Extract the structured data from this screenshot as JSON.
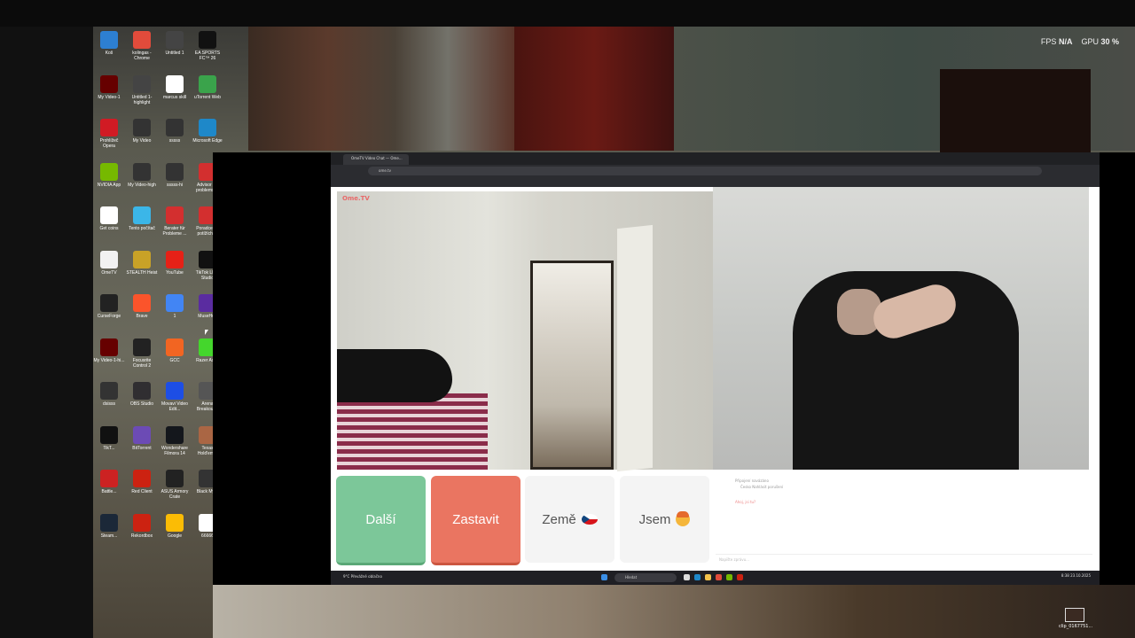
{
  "overlay": {
    "fps_label": "FPS",
    "fps_value": "N/A",
    "gpu_label": "GPU",
    "gpu_value": "30 %"
  },
  "desktop_icons": [
    {
      "label": "Koš",
      "color": "#2d7fd1"
    },
    {
      "label": "kolingas - Chrome",
      "color": "#e14b3b"
    },
    {
      "label": "Untitled 1",
      "color": "#444"
    },
    {
      "label": "EA SPORTS FC™ 26",
      "color": "#111"
    },
    {
      "label": "My Video-1",
      "color": "#600"
    },
    {
      "label": "Untitled 1-highlight",
      "color": "#444"
    },
    {
      "label": "marcus skill",
      "color": "#fff"
    },
    {
      "label": "uTorrent Web",
      "color": "#3aa34b"
    },
    {
      "label": "Prohlížeč Opera",
      "color": "#d11b24"
    },
    {
      "label": "My Video",
      "color": "#333"
    },
    {
      "label": "sssss",
      "color": "#333"
    },
    {
      "label": "Microsoft Edge",
      "color": "#1e88c9"
    },
    {
      "label": "NVIDIA App",
      "color": "#76b900"
    },
    {
      "label": "My Video-high",
      "color": "#333"
    },
    {
      "label": "sssss-hi",
      "color": "#333"
    },
    {
      "label": "Advisor for problems ...",
      "color": "#d32f2f"
    },
    {
      "label": "Get coins",
      "color": "#fff"
    },
    {
      "label": "Tento počítač",
      "color": "#3bb6e8"
    },
    {
      "label": "Berater für Probleme ...",
      "color": "#d32f2f"
    },
    {
      "label": "Poradce při potížích ...",
      "color": "#d32f2f"
    },
    {
      "label": "OmeTV",
      "color": "#f2f2f2"
    },
    {
      "label": "STEALTH Heist",
      "color": "#c9a227"
    },
    {
      "label": "YouTube",
      "color": "#e62117"
    },
    {
      "label": "TikTok LIVE Studio",
      "color": "#111"
    },
    {
      "label": "CurseForge",
      "color": "#222"
    },
    {
      "label": "Brave",
      "color": "#fb542b"
    },
    {
      "label": "1",
      "color": "#4285f4"
    },
    {
      "label": "MuseHub",
      "color": "#5a2ca0"
    },
    {
      "label": "My Video-1-hi...",
      "color": "#600"
    },
    {
      "label": "Focusrite Control 2",
      "color": "#222"
    },
    {
      "label": "GCC",
      "color": "#f26522"
    },
    {
      "label": "Razer Axon",
      "color": "#44d62c"
    },
    {
      "label": "dsisss",
      "color": "#333"
    },
    {
      "label": "OBS Studio",
      "color": "#302e31"
    },
    {
      "label": "Movavi Video Edit...",
      "color": "#1d4ee5"
    },
    {
      "label": "Arena Breakout...",
      "color": "#555"
    },
    {
      "label": "TikT...",
      "color": "#111"
    },
    {
      "label": "BitTorrent",
      "color": "#6c4bb5"
    },
    {
      "label": "Wondershare Filmora 14",
      "color": "#14171c"
    },
    {
      "label": "Texas Hold'em...",
      "color": "#aa6644"
    },
    {
      "label": "Battle...",
      "color": "#c22"
    },
    {
      "label": "Red Client",
      "color": "#c21"
    },
    {
      "label": "ASUS Armory Crate",
      "color": "#222"
    },
    {
      "label": "Black Myth",
      "color": "#333"
    },
    {
      "label": "Steam...",
      "color": "#1b2838"
    },
    {
      "label": "Rekordbox",
      "color": "#c21"
    },
    {
      "label": "Google",
      "color": "#fbbc05"
    },
    {
      "label": "66666",
      "color": "#fff"
    }
  ],
  "browser": {
    "tab_title": "OmeTV Video Chat — Ome...",
    "url": "ome.tv"
  },
  "page": {
    "logo": "Ome.TV",
    "buttons": {
      "next": "Další",
      "stop": "Zastavit",
      "country": "Země",
      "gender": "Jsem"
    },
    "chat": {
      "messages": [
        "Připojení navázáno",
        "Česko  Nahlásit porušení",
        "Ahoj, jsi tu?"
      ],
      "placeholder": "Napište zprávu..."
    }
  },
  "taskbar": {
    "search": "Hledat",
    "weather": "9°C Převážně oblačno",
    "time": "8:38",
    "date": "23.10.2025"
  },
  "desktop_file": {
    "label": "clip_0167751..."
  }
}
